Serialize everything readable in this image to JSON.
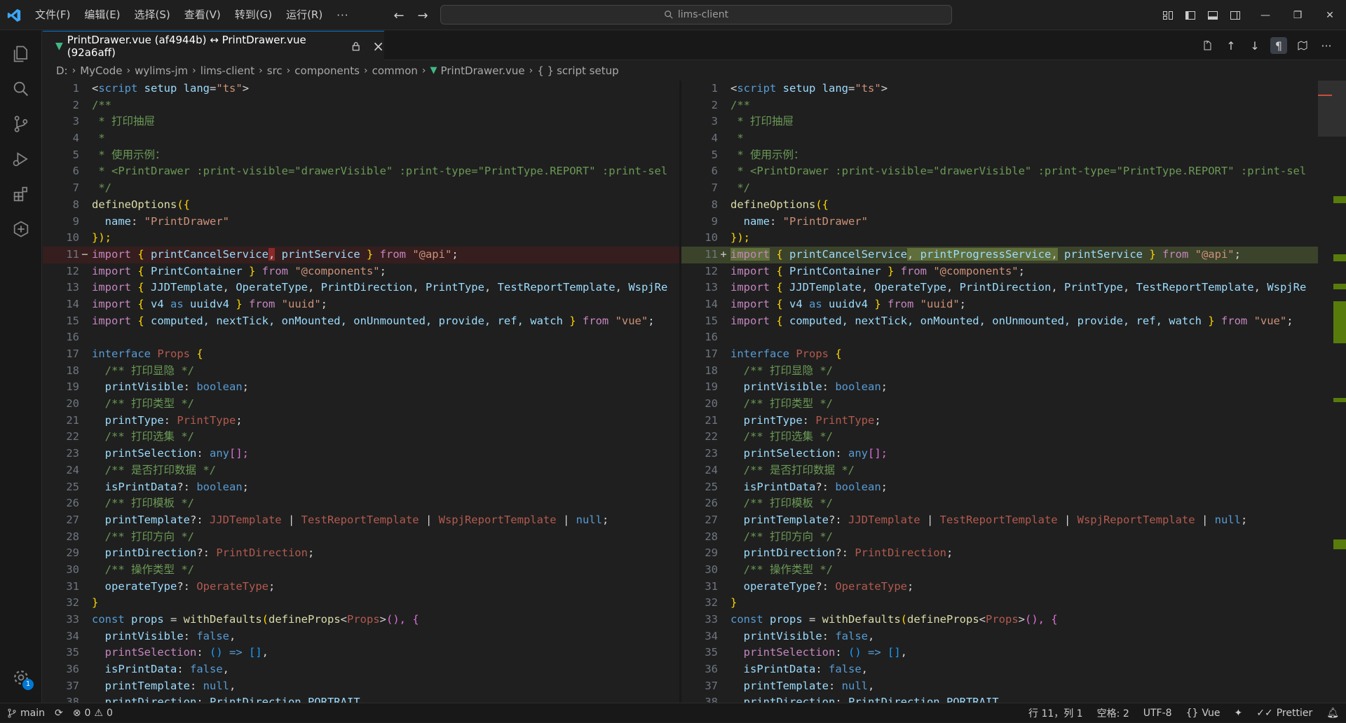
{
  "menu": [
    "文件(F)",
    "编辑(E)",
    "选择(S)",
    "查看(V)",
    "转到(G)",
    "运行(R)"
  ],
  "menu_more": "···",
  "search": {
    "text": "lims-client"
  },
  "tab": {
    "title": "PrintDrawer.vue (af4944b) ↔ PrintDrawer.vue (92a6aff)"
  },
  "breadcrumb": [
    "D:",
    "MyCode",
    "wylims-jm",
    "lims-client",
    "src",
    "components",
    "common",
    "PrintDrawer.vue",
    "script setup"
  ],
  "activity_badge": "1",
  "status": {
    "branch": "main",
    "errors": "0",
    "warnings": "0",
    "position": "行 11，列 1",
    "spaces": "空格: 2",
    "encoding": "UTF-8",
    "language": "Vue",
    "formatter": "Prettier"
  },
  "line_numbers": [
    "1",
    "2",
    "3",
    "4",
    "5",
    "6",
    "7",
    "8",
    "9",
    "10",
    "11",
    "12",
    "13",
    "14",
    "15",
    "16",
    "17",
    "18",
    "19",
    "20",
    "21",
    "22",
    "23",
    "24",
    "25",
    "26",
    "27",
    "28",
    "29",
    "30",
    "31",
    "32",
    "33",
    "34",
    "35",
    "36",
    "37",
    "38"
  ],
  "markers": {
    "left_11": "−",
    "right_11": "+"
  },
  "code": {
    "l1a": "<",
    "l1b": "script",
    "l1c": " setup",
    "l1d": " lang",
    "l1e": "=",
    "l1f": "\"ts\"",
    "l1g": ">",
    "l2": "/**",
    "l3": " * 打印抽屉",
    "l4": " *",
    "l5": " * 使用示例：",
    "l6": " * <PrintDrawer :print-visible=\"drawerVisible\" :print-type=\"PrintType.REPORT\" :print-sel",
    "l7": " */",
    "l8a": "defineOptions",
    "l8b": "({",
    "l9a": "  name",
    "l9b": ": ",
    "l9c": "\"PrintDrawer\"",
    "l10": "});",
    "l11_import": "import",
    "l11_open": " { ",
    "l11_cancel": "printCancelService",
    "l11_comma": ",",
    "l11_sp": " ",
    "l11_progress": "printProgressService",
    "l11_comma2": ",",
    "l11_print": "printService",
    "l11_close": " } ",
    "l11_from": "from",
    "l11_str": " \"@api\"",
    "l11_semi": ";",
    "l12a": "import",
    "l12b": " { ",
    "l12c": "PrintContainer",
    "l12d": " } ",
    "l12e": "from",
    "l12f": " \"@components\"",
    "l12g": ";",
    "l13a": "import",
    "l13b": " { ",
    "l13c": "JJDTemplate",
    "l13d": ", ",
    "l13e": "OperateType",
    "l13f": ", ",
    "l13g": "PrintDirection",
    "l13h": ", ",
    "l13i": "PrintType",
    "l13j": ", ",
    "l13k": "TestReportTemplate",
    "l13l": ", ",
    "l13m": "WspjRe",
    "l14a": "import",
    "l14b": " { ",
    "l14c": "v4",
    "l14d": " as ",
    "l14e": "uuidv4",
    "l14f": " } ",
    "l14g": "from",
    "l14h": " \"uuid\"",
    "l14i": ";",
    "l15a": "import",
    "l15b": " { ",
    "l15c": "computed, nextTick, onMounted, onUnmounted, provide, ref, watch",
    "l15d": " } ",
    "l15e": "from",
    "l15f": " \"vue\"",
    "l15g": ";",
    "l17a": "interface",
    "l17b": " Props",
    "l17c": " {",
    "l18": "  /** 打印显隐 */",
    "l19a": "  printVisible",
    "l19b": ": ",
    "l19c": "boolean",
    "l19d": ";",
    "l20": "  /** 打印类型 */",
    "l21a": "  printType",
    "l21b": ": ",
    "l21c": "PrintType",
    "l21d": ";",
    "l22": "  /** 打印选集 */",
    "l23a": "  printSelection",
    "l23b": ": ",
    "l23c": "any",
    "l23d": "[];",
    "l24": "  /** 是否打印数据 */",
    "l25a": "  isPrintData",
    "l25b": "?: ",
    "l25c": "boolean",
    "l25d": ";",
    "l26": "  /** 打印模板 */",
    "l27a": "  printTemplate",
    "l27b": "?: ",
    "l27c": "JJDTemplate",
    "l27d": " | ",
    "l27e": "TestReportTemplate",
    "l27f": " | ",
    "l27g": "WspjReportTemplate",
    "l27h": " | ",
    "l27i": "null",
    "l27j": ";",
    "l28": "  /** 打印方向 */",
    "l29a": "  printDirection",
    "l29b": "?: ",
    "l29c": "PrintDirection",
    "l29d": ";",
    "l30": "  /** 操作类型 */",
    "l31a": "  operateType",
    "l31b": "?: ",
    "l31c": "OperateType",
    "l31d": ";",
    "l32": "}",
    "l33a": "const",
    "l33b": " props",
    "l33c": " = ",
    "l33d": "withDefaults",
    "l33e": "(",
    "l33f": "defineProps",
    "l33g": "<",
    "l33h": "Props",
    "l33i": ">",
    "l33j": "(), {",
    "l34a": "  printVisible",
    "l34b": ": ",
    "l34c": "false",
    "l34d": ",",
    "l35a": "  printSelection",
    "l35b": ": ",
    "l35c": "()",
    "l35d": " => ",
    "l35e": "[]",
    "l35f": ",",
    "l36a": "  isPrintData",
    "l36b": ": ",
    "l36c": "false",
    "l36d": ",",
    "l37a": "  printTemplate",
    "l37b": ": ",
    "l37c": "null",
    "l37d": ",",
    "l38a": "  printDirection",
    "l38b": ": ",
    "l38c": "PrintDirection.PORTRAIT"
  }
}
